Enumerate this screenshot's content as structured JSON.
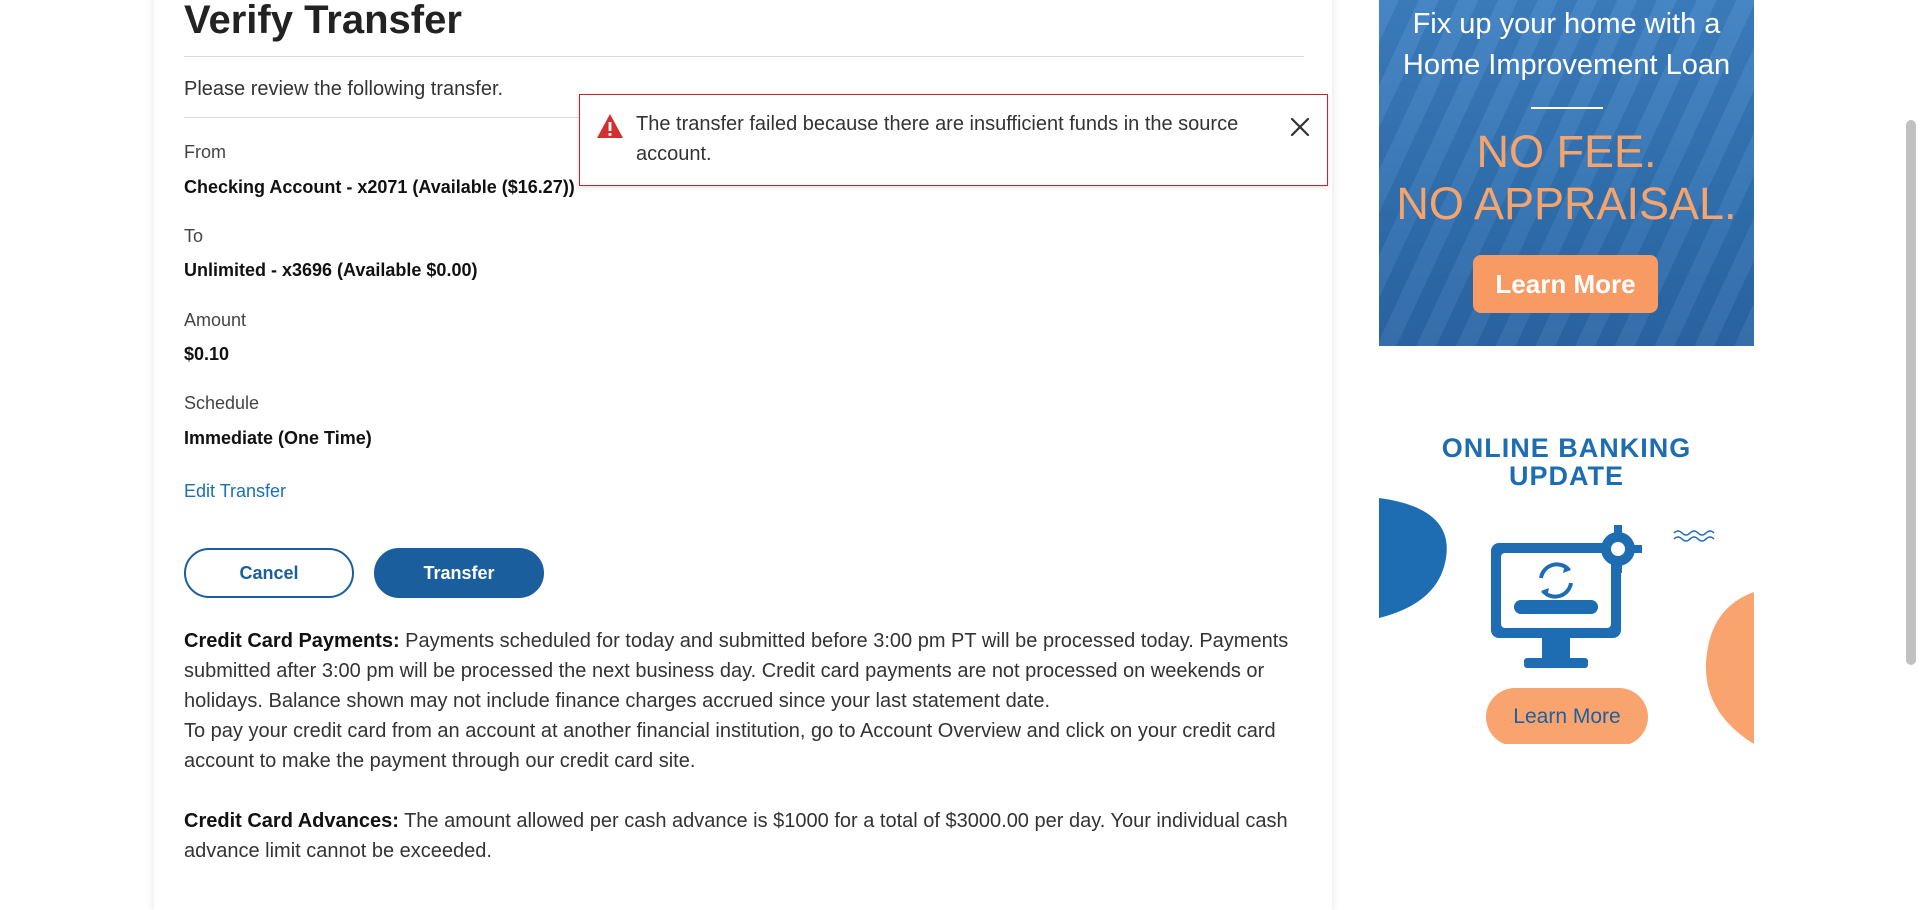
{
  "page": {
    "title": "Verify Transfer",
    "intro": "Please review the following transfer."
  },
  "fields": [
    {
      "label": "From",
      "value": "Checking Account - x2071 (Available  ($16.27))"
    },
    {
      "label": "To",
      "value": "Unlimited - x3696 (Available  $0.00)"
    },
    {
      "label": "Amount",
      "value": "$0.10"
    },
    {
      "label": "Schedule",
      "value": "Immediate (One Time)"
    }
  ],
  "edit_link": "Edit Transfer",
  "buttons": {
    "cancel": "Cancel",
    "transfer": "Transfer"
  },
  "notes": {
    "cc_payments_heading": "Credit Card Payments:",
    "cc_payments_text": " Payments scheduled for today and submitted before 3:00 pm PT will be processed today. Payments submitted after 3:00 pm will be processed the next business day. Credit card payments are not processed on weekends or holidays. Balance shown may not include finance charges accrued since your last statement date.",
    "cc_other_institution": "To pay your credit card from an account at another financial institution, go to Account Overview and click on your credit card account to make the payment through our credit card site.",
    "cc_advances_heading": "Credit Card Advances:",
    "cc_advances_text": " The amount allowed per cash advance is $1000 for a total of $3000.00 per day. Your individual cash advance limit cannot be exceeded."
  },
  "alert": {
    "icon": "warning-triangle-icon",
    "message": "The transfer failed because there are insufficient funds in the source account.",
    "close_icon": "close-icon",
    "border_color": "#c8232c"
  },
  "ads": {
    "home_improvement": {
      "headline_line1": "Fix up your home with a",
      "headline_line2": "Home Improvement Loan",
      "offer_line1": "NO FEE.",
      "offer_line2": "NO APPRAISAL.",
      "button": "Learn More"
    },
    "online_banking": {
      "title_line1": "ONLINE BANKING",
      "title_line2": "UPDATE",
      "icon": "computer-sync-icon",
      "button": "Learn More"
    }
  },
  "colors": {
    "primary": "#1a5e9e",
    "link": "#1a6fb5",
    "alert": "#c8232c",
    "ad_orange": "#f79a63"
  }
}
